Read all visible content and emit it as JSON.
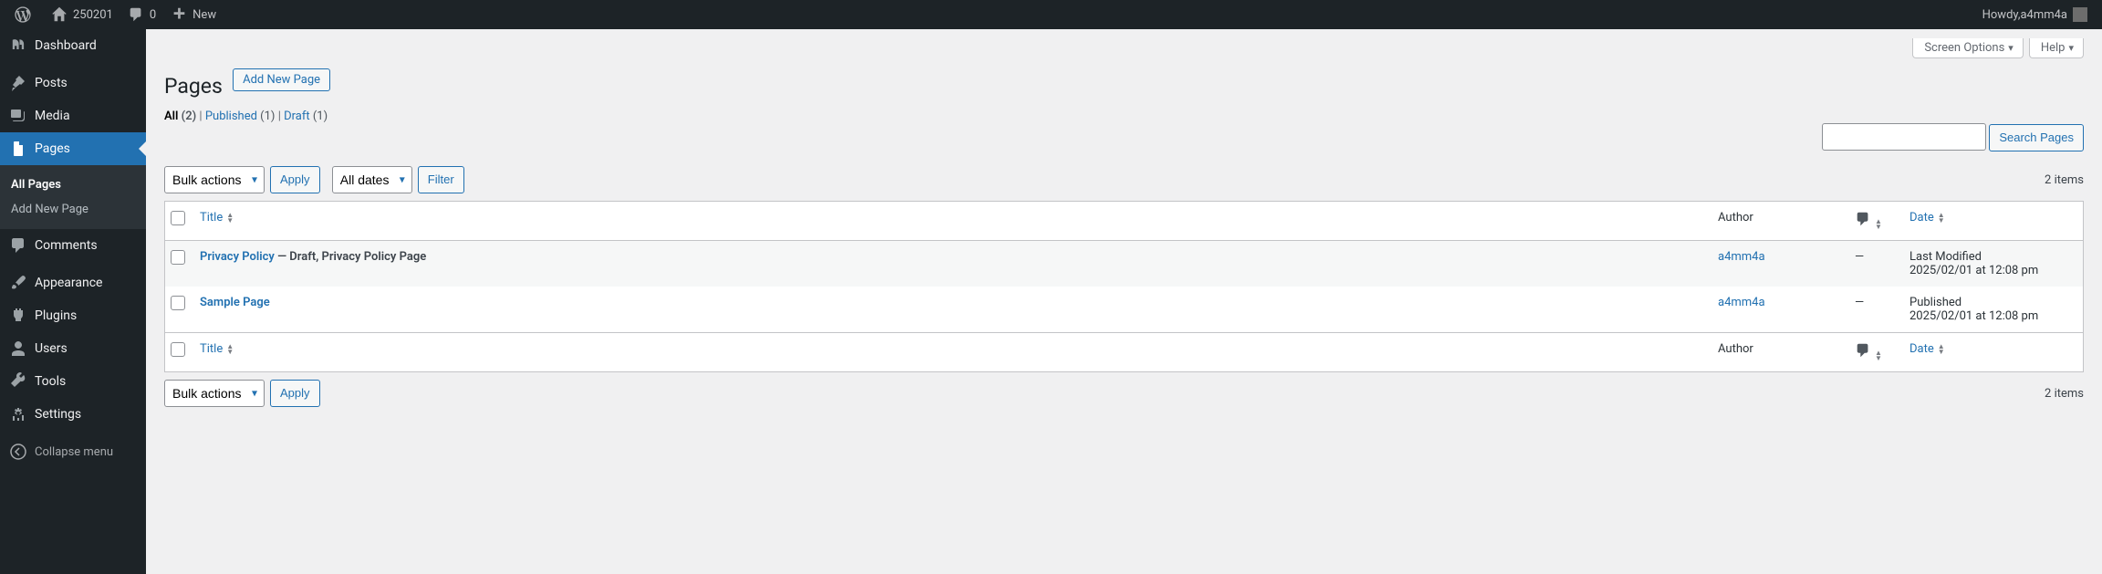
{
  "adminbar": {
    "site_title": "250201",
    "comments_count": "0",
    "new_label": "New",
    "howdy_prefix": "Howdy, ",
    "user_display": "a4mm4a"
  },
  "sidemenu": {
    "dashboard": "Dashboard",
    "posts": "Posts",
    "media": "Media",
    "pages": "Pages",
    "pages_sub_all": "All Pages",
    "pages_sub_add": "Add New Page",
    "comments": "Comments",
    "appearance": "Appearance",
    "plugins": "Plugins",
    "users": "Users",
    "tools": "Tools",
    "settings": "Settings",
    "collapse": "Collapse menu"
  },
  "screen_meta": {
    "screen_options": "Screen Options",
    "help": "Help"
  },
  "heading": "Pages",
  "add_new_button": "Add New Page",
  "views": {
    "all_label": "All",
    "all_count": "(2)",
    "published_label": "Published",
    "published_count": "(1)",
    "draft_label": "Draft",
    "draft_count": "(1)"
  },
  "search": {
    "button": "Search Pages"
  },
  "bulk": {
    "select_label": "Bulk actions",
    "apply_label": "Apply"
  },
  "filter": {
    "dates_label": "All dates",
    "filter_button": "Filter"
  },
  "items_count": "2 items",
  "columns": {
    "title": "Title",
    "author": "Author",
    "date": "Date"
  },
  "rows": [
    {
      "title": "Privacy Policy",
      "post_state": " — Draft, Privacy Policy Page",
      "author": "a4mm4a",
      "comments": "—",
      "date_status": "Last Modified",
      "date_value": "2025/02/01 at 12:08 pm"
    },
    {
      "title": "Sample Page",
      "post_state": "",
      "author": "a4mm4a",
      "comments": "—",
      "date_status": "Published",
      "date_value": "2025/02/01 at 12:08 pm"
    }
  ]
}
